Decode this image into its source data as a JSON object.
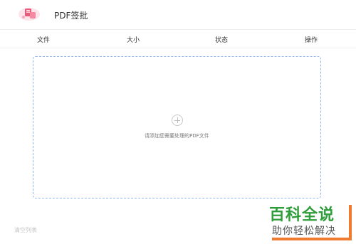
{
  "app": {
    "title": "PDF签批"
  },
  "table": {
    "columns": [
      "文件",
      "大小",
      "状态",
      "操作"
    ]
  },
  "dropzone": {
    "hint": "请添加您需要处理的PDF文件",
    "icon": "plus-circle-icon"
  },
  "footer": {
    "clear_label": "清空列表"
  },
  "watermark": {
    "line1": "百科全说",
    "line2": "助你轻松解决"
  },
  "colors": {
    "dropzone_border": "#8fb6ee",
    "logo_pink": "#e85a78",
    "watermark_green": "#2f9e3a",
    "watermark_orange": "#f07b2e"
  }
}
